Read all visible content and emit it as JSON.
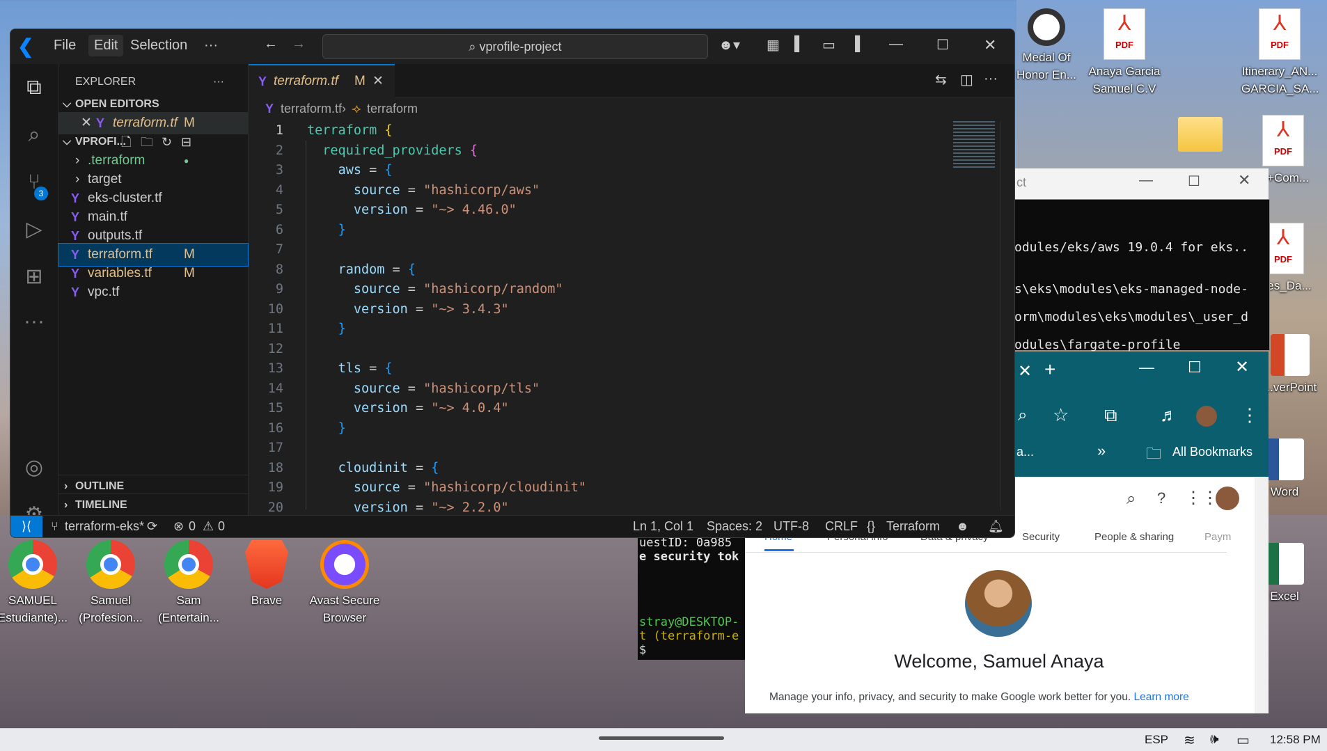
{
  "desktop": {
    "top_icons": [
      {
        "label": "Medal Of Honor En...",
        "icon": "media-player-icon"
      },
      {
        "label": "Anaya Garcia Samuel C.V",
        "icon": "pdf-icon"
      },
      {
        "label": "Itinerary_AN... GARCIA_SA...",
        "icon": "pdf-icon"
      },
      {
        "label": "...+Com...",
        "icon": "pdf-icon"
      },
      {
        "label": "...les_Da...",
        "icon": "pdf-icon"
      },
      {
        "label": "...verPoint",
        "icon": "powerpoint-icon"
      },
      {
        "label": "Word",
        "icon": "word-icon"
      },
      {
        "label": "Excel",
        "icon": "excel-icon"
      }
    ],
    "bottom_icons": [
      {
        "label": "SAMUEL Estudiante)...",
        "icon": "chrome-icon"
      },
      {
        "label": "Samuel (Profesion...",
        "icon": "chrome-icon"
      },
      {
        "label": "Sam (Entertain...",
        "icon": "chrome-icon"
      },
      {
        "label": "Brave",
        "icon": "brave-icon"
      },
      {
        "label": "Avast Secure Browser",
        "icon": "avast-icon"
      }
    ]
  },
  "vscode": {
    "menu": [
      "File",
      "Edit",
      "Selection",
      "···"
    ],
    "search_text": "vprofile-project",
    "explorer_title": "EXPLORER",
    "open_editors_label": "OPEN EDITORS",
    "open_editor_file": "terraform.tf",
    "open_editor_badge": "M",
    "project_label": "VPROFI...",
    "tree": [
      {
        "name": ".terraform",
        "type": "folder",
        "badge": "●"
      },
      {
        "name": "target",
        "type": "folder",
        "badge": ""
      },
      {
        "name": "eks-cluster.tf",
        "type": "file",
        "badge": ""
      },
      {
        "name": "main.tf",
        "type": "file",
        "badge": ""
      },
      {
        "name": "outputs.tf",
        "type": "file",
        "badge": ""
      },
      {
        "name": "terraform.tf",
        "type": "file",
        "badge": "M"
      },
      {
        "name": "variables.tf",
        "type": "file",
        "badge": "M"
      },
      {
        "name": "vpc.tf",
        "type": "file",
        "badge": ""
      }
    ],
    "outline_label": "OUTLINE",
    "timeline_label": "TIMELINE",
    "tab_label": "terraform.tf",
    "tab_badge": "M",
    "breadcrumb_file": "terraform.tf",
    "breadcrumb_symbol": "terraform",
    "scm_badge": "3",
    "status": {
      "branch": "terraform-eks*",
      "errors": "0",
      "warnings": "0",
      "position": "Ln 1, Col 1",
      "spaces": "Spaces: 2",
      "encoding": "UTF-8",
      "eol": "CRLF",
      "language": "Terraform"
    }
  },
  "terminal": {
    "lines": [
      "odules/eks/aws 19.0.4 for eks..",
      "",
      "s\\eks\\modules\\eks-managed-node-",
      "orm\\modules\\eks\\modules\\_user_d",
      "odules\\fargate-profile"
    ],
    "lower_lines": [
      "uestID: 0a985",
      "e security tok",
      "",
      "",
      "",
      "stray@DESKTOP-",
      "t (terraform-e",
      "$ "
    ]
  },
  "chrome_window": {
    "bookmarks_label": "All Bookmarks",
    "tab_fragment": "a...",
    "account_tabs": [
      "Home",
      "Personal info",
      "Data & privacy",
      "Security",
      "People & sharing",
      "Paym"
    ],
    "welcome": "Welcome, Samuel Anaya",
    "subtitle": "Manage your info, privacy, and security to make Google work better for you.",
    "learn_more": "Learn more"
  },
  "taskbar": {
    "lang": "ESP",
    "time": "12:58 PM"
  }
}
